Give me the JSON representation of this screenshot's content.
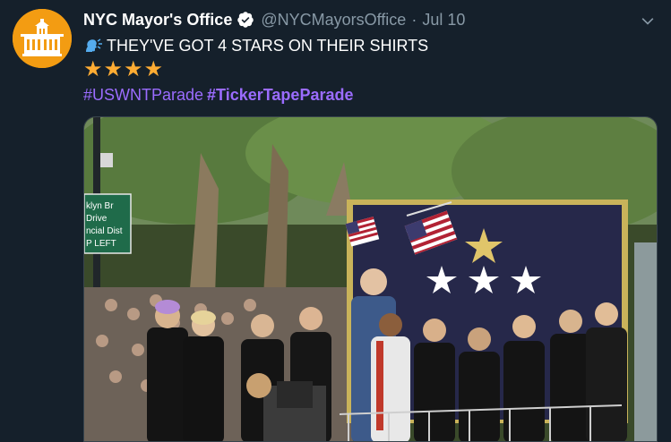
{
  "tweet": {
    "display_name": "NYC Mayor's Office",
    "handle": "@NYCMayorsOffice",
    "separator": "·",
    "date": "Jul 10",
    "text": "THEY'VE GOT 4 STARS ON THEIR SHIRTS",
    "speaking_icon": "speaking-head-icon",
    "stars": "★★★★",
    "hashtags": [
      {
        "text": "#USWNTParade",
        "bold": false
      },
      {
        "text": "#TickerTapeParade",
        "bold": true
      }
    ]
  },
  "media": {
    "street_sign_lines": [
      "klyn Br",
      "Drive",
      "ncial Dist",
      "P LEFT"
    ]
  },
  "colors": {
    "background": "#15202b",
    "hashtag": "#9b6cff",
    "secondary_text": "#8899a6",
    "verified": "#ffffff",
    "star": "#ffac33"
  }
}
